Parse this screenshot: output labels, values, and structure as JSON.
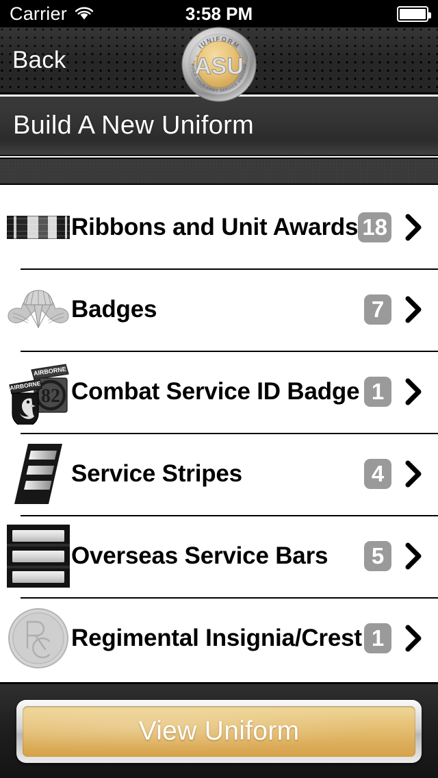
{
  "status_bar": {
    "carrier": "Carrier",
    "time": "3:58 PM",
    "wifi_icon": "wifi-icon",
    "battery_icon": "battery-full-icon"
  },
  "nav_bar": {
    "back_label": "Back",
    "logo": {
      "top_text": "iUNIFORM",
      "center_text": "ASU",
      "bottom_text": "BUILD YOUR ARMY SERVICE UNIFORM",
      "ring_color": "#b9b9b9",
      "face_color": "#e8c06a"
    }
  },
  "page": {
    "title": "Build A New Uniform"
  },
  "list": {
    "rows": [
      {
        "label": "Ribbons and Unit Awards",
        "count": "18",
        "icon": "ribbon-rack-icon",
        "chevron": "chevron-right-icon"
      },
      {
        "label": "Badges",
        "count": "7",
        "icon": "parachutist-wings-icon",
        "chevron": "chevron-right-icon"
      },
      {
        "label": "Combat Service ID Badge",
        "count": "1",
        "icon": "airborne-patches-icon",
        "chevron": "chevron-right-icon"
      },
      {
        "label": "Service Stripes",
        "count": "4",
        "icon": "service-stripes-icon",
        "chevron": "chevron-right-icon"
      },
      {
        "label": "Overseas Service Bars",
        "count": "5",
        "icon": "overseas-bars-icon",
        "chevron": "chevron-right-icon"
      },
      {
        "label": "Regimental Insignia/Crest",
        "count": "1",
        "icon": "regimental-crest-icon",
        "chevron": "chevron-right-icon"
      }
    ]
  },
  "toolbar": {
    "view_uniform_label": "View Uniform"
  },
  "colors": {
    "badge_background": "#9a9a9a",
    "button_gold": "#e0b860",
    "navbar_dark": "#262626",
    "accent_white": "#ffffff"
  }
}
